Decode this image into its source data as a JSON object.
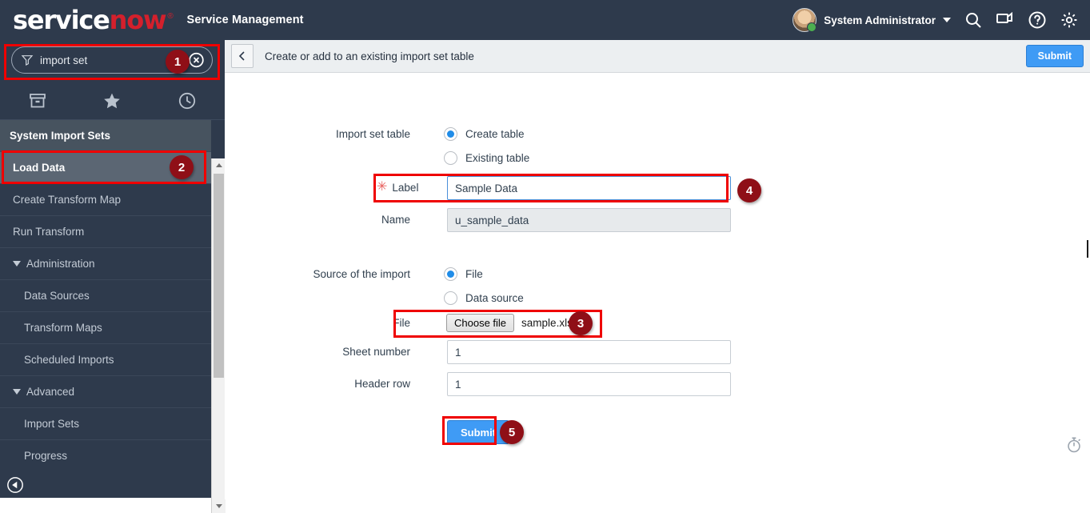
{
  "topbar": {
    "logo_first": "service",
    "logo_second": "now",
    "logo_registered": "®",
    "product_name": "Service Management",
    "user_name": "System Administrator",
    "icons": [
      "search-icon",
      "chat-icon",
      "help-icon",
      "gear-icon"
    ]
  },
  "sidebar": {
    "search": {
      "value": "import set",
      "filter_icon": "filter-icon",
      "clear_icon": "clear-circle-icon"
    },
    "tabs": [
      {
        "name": "all-applications",
        "icon": "archive-box-icon"
      },
      {
        "name": "favorites",
        "icon": "star-icon"
      },
      {
        "name": "history",
        "icon": "clock-icon"
      }
    ],
    "section_header": "System Import Sets",
    "items": [
      {
        "label": "Load Data",
        "level": 1,
        "active": true,
        "group": false
      },
      {
        "label": "Create Transform Map",
        "level": 1,
        "active": false,
        "group": false
      },
      {
        "label": "Run Transform",
        "level": 1,
        "active": false,
        "group": false
      },
      {
        "label": "Administration",
        "level": 1,
        "active": false,
        "group": true
      },
      {
        "label": "Data Sources",
        "level": 2,
        "active": false,
        "group": false
      },
      {
        "label": "Transform Maps",
        "level": 2,
        "active": false,
        "group": false
      },
      {
        "label": "Scheduled Imports",
        "level": 2,
        "active": false,
        "group": false
      },
      {
        "label": "Advanced",
        "level": 1,
        "active": false,
        "group": true
      },
      {
        "label": "Import Sets",
        "level": 2,
        "active": false,
        "group": false
      },
      {
        "label": "Progress",
        "level": 2,
        "active": false,
        "group": false
      }
    ],
    "collapse_icon": "collapse-left-icon"
  },
  "content": {
    "breadcrumb_title": "Create or add to an existing import set table",
    "back_icon": "chevron-left-icon",
    "top_submit_label": "Submit",
    "timer_icon": "stopwatch-icon"
  },
  "form": {
    "import_set_table_label": "Import set table",
    "radio_create_table": "Create table",
    "radio_existing_table": "Existing table",
    "import_set_table_selected": "Create table",
    "label_field_label": "Label",
    "label_field_value": "Sample Data",
    "label_required_marker": "✳",
    "name_field_label": "Name",
    "name_field_value": "u_sample_data",
    "source_label": "Source of the import",
    "radio_file": "File",
    "radio_data_source": "Data source",
    "source_selected": "File",
    "file_label": "File",
    "choose_file_button": "Choose file",
    "file_name": "sample.xlsx",
    "sheet_number_label": "Sheet number",
    "sheet_number_value": "1",
    "header_row_label": "Header row",
    "header_row_value": "1",
    "submit_label": "Submit"
  },
  "annotations": {
    "markers": [
      {
        "number": "1",
        "target": "search-box"
      },
      {
        "number": "2",
        "target": "load-data-nav-item"
      },
      {
        "number": "3",
        "target": "file-chooser-row"
      },
      {
        "number": "4",
        "target": "label-field-row"
      },
      {
        "number": "5",
        "target": "form-submit-button"
      }
    ],
    "highlight_color": "#ef0000",
    "marker_color": "#8f0f17"
  }
}
